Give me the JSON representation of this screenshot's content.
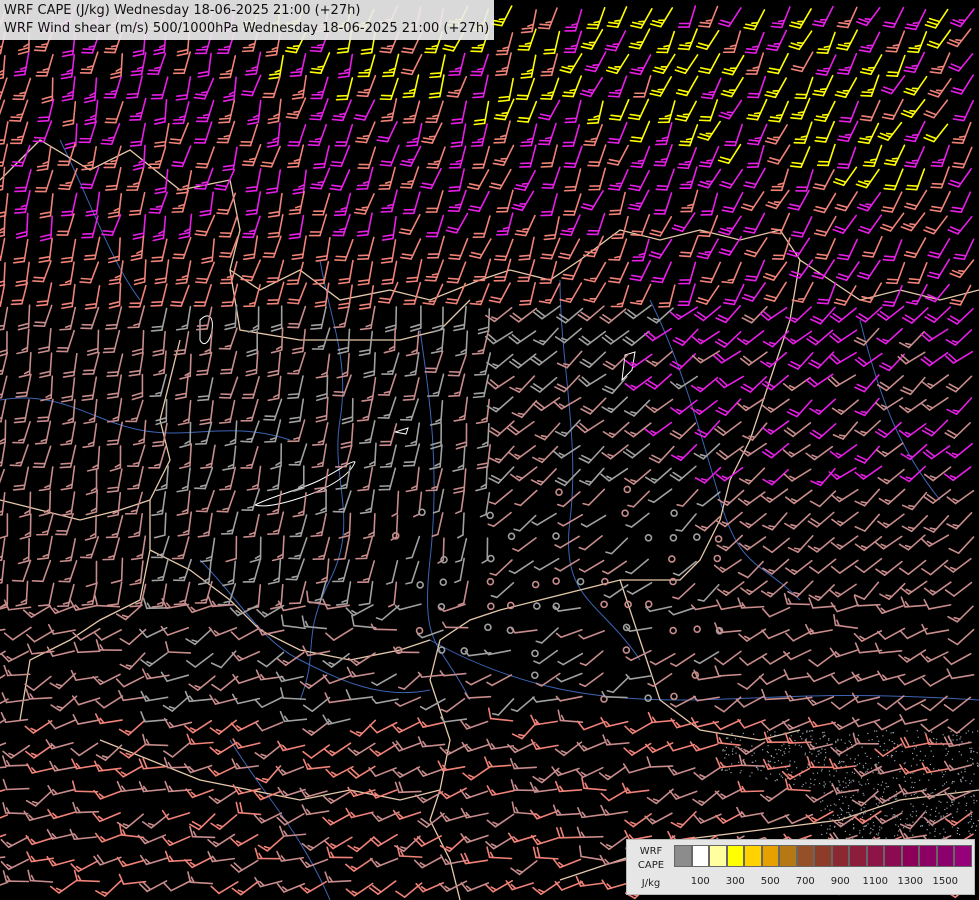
{
  "title": {
    "line1": "WRF CAPE (J/kg) Wednesday 18-06-2025 21:00 (+27h)",
    "line2": "WRF Wind shear (m/s) 500/1000hPa Wednesday 18-06-2025 21:00 (+27h)"
  },
  "legend": {
    "label_line1": "WRF",
    "label_line2": "CAPE",
    "label_line3": "J/kg",
    "colors": [
      "#8c8c8c",
      "#ffffff",
      "#ffffa0",
      "#ffff00",
      "#ffd200",
      "#e6a000",
      "#b47814",
      "#965028",
      "#8c3c28",
      "#8c2832",
      "#8c1e3c",
      "#8c1446",
      "#8c0a50",
      "#8c005a",
      "#8c0064",
      "#8c006e",
      "#960078"
    ],
    "ticks": [
      {
        "label": "100",
        "index": 1
      },
      {
        "label": "300",
        "index": 3
      },
      {
        "label": "500",
        "index": 5
      },
      {
        "label": "700",
        "index": 7
      },
      {
        "label": "900",
        "index": 9
      },
      {
        "label": "1100",
        "index": 11
      },
      {
        "label": "1300",
        "index": 13
      },
      {
        "label": "1500",
        "index": 15
      }
    ]
  },
  "colors": {
    "background": "#000000",
    "barb_low": "#a0a0a0",
    "barb_mid": "#c88c8c",
    "barb_salmon": "#f08278",
    "barb_magenta": "#e61ee6",
    "barb_yellow": "#ffff00",
    "borders": "#e6c8aa",
    "rivers": "#3c64b4",
    "lakes": "#ffffff"
  }
}
